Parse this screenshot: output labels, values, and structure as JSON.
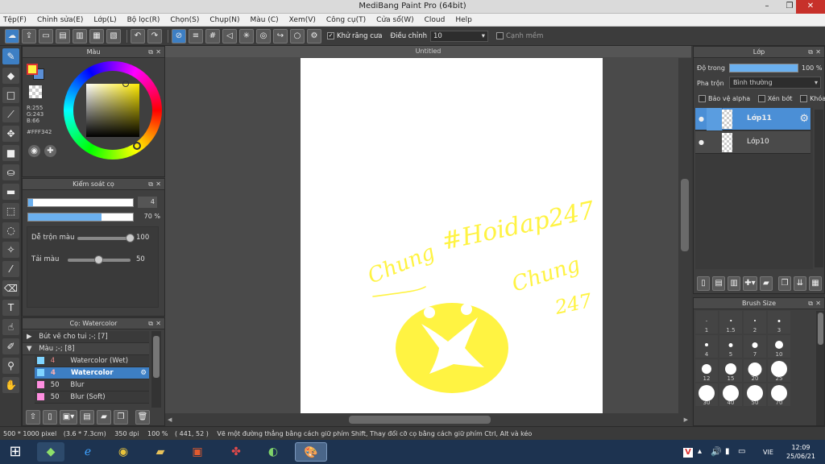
{
  "app": {
    "title": "MediBang Paint Pro (64bit)"
  },
  "window_controls": {
    "minimize": "–",
    "maximize": "❐",
    "close": "✕"
  },
  "menu": [
    "Tệp(F)",
    "Chỉnh sửa(E)",
    "Lớp(L)",
    "Bộ lọc(R)",
    "Chọn(S)",
    "Chụp(N)",
    "Màu (C)",
    "Xem(V)",
    "Công cụ(T)",
    "Cửa sổ(W)",
    "Cloud",
    "Help"
  ],
  "toolbar": {
    "antialias_label": "Khử răng cưa",
    "antialias_checked": true,
    "adjust_label": "Điều chỉnh",
    "adjust_value": "10",
    "margin_label": "Cạnh mềm",
    "margin_checked": false
  },
  "color_panel": {
    "title": "Màu",
    "r": "R:255",
    "g": "G:243",
    "b": "B:66",
    "hex": "#FFF342",
    "primary_color": "#FFF342",
    "secondary_color": "#5b8fd6"
  },
  "brush_control": {
    "title": "Kiểm soát cọ",
    "size_value": "4",
    "opacity_value": "70 %",
    "opacity_fraction": 0.7,
    "mix_label": "Dễ trộn màu",
    "mix_value": "100",
    "mix_fraction": 1.0,
    "load_label": "Tải màu",
    "load_value": "50",
    "load_fraction": 0.5
  },
  "brush_panel": {
    "title": "Cọ: Watercolor",
    "groups": [
      {
        "label": "Bút vẽ cho tui ;-; [7]",
        "expanded": false
      },
      {
        "label": "Màu ;-; [8]",
        "expanded": true
      }
    ],
    "items": [
      {
        "size": "4",
        "name": "Watercolor (Wet)",
        "color": "#7fd4ff",
        "selected": false
      },
      {
        "size": "4",
        "name": "Watercolor",
        "color": "#7fd4ff",
        "selected": true
      },
      {
        "size": "50",
        "name": "Blur",
        "color": "#ff8fe0",
        "selected": false
      },
      {
        "size": "50",
        "name": "Blur (Soft)",
        "color": "#ff8fe0",
        "selected": false
      }
    ]
  },
  "canvas": {
    "tab_title": "Untitled"
  },
  "drawing_text": {
    "line1": "#Hoidap247",
    "signature1": "Chung",
    "signature2": "Chung",
    "signature3": "247",
    "ink_color": "#FFF342"
  },
  "layer_panel": {
    "title": "Lớp",
    "opacity_label": "Độ trong",
    "opacity_value": "100 %",
    "opacity_fraction": 1.0,
    "blend_label": "Pha trộn",
    "blend_value": "Bình thường",
    "protect_alpha": "Bảo vệ alpha",
    "clipping": "Xén bớt",
    "lock": "Khóa",
    "layers": [
      {
        "name": "Lớp11",
        "selected": true
      },
      {
        "name": "Lớp10",
        "selected": false
      }
    ]
  },
  "brush_size_panel": {
    "title": "Brush Size",
    "sizes": [
      "1",
      "1.5",
      "2",
      "3",
      "4",
      "5",
      "7",
      "10",
      "12",
      "15",
      "20",
      "25",
      "30",
      "40",
      "50",
      "70"
    ]
  },
  "status": {
    "canvas_size": "500 * 1000 pixel",
    "physical": "(3.6 * 7.3cm)",
    "dpi": "350 dpi",
    "zoom": "100 %",
    "cursor": "( 441, 52 )",
    "hint": "Vẽ một đường thẳng bằng cách giữ phím Shift, Thay đổi cỡ cọ bằng cách giữ phím Ctrl, Alt và kéo"
  },
  "taskbar": {
    "language": "VIE",
    "time": "12:09",
    "date": "25/06/21"
  }
}
